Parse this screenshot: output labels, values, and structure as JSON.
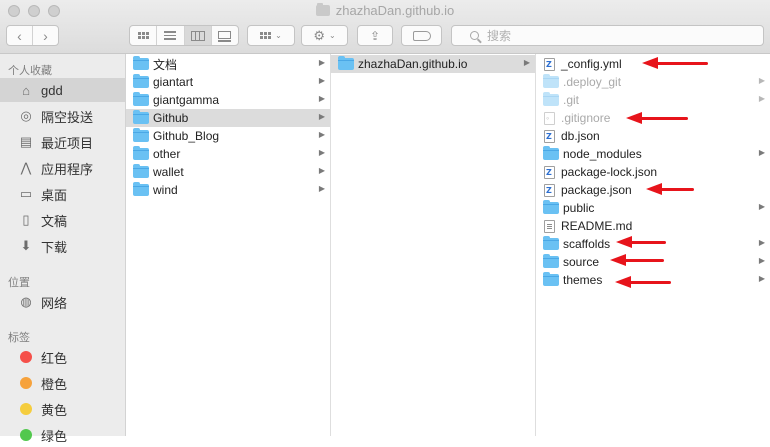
{
  "window": {
    "title": "zhazhaDan.github.io"
  },
  "toolbar": {
    "back_icon": "chevron-left-icon",
    "forward_icon": "chevron-right-icon",
    "share_icon": "share-icon",
    "tag_icon": "tag-icon",
    "action_icon": "gear-icon",
    "search": {
      "placeholder": "搜索"
    }
  },
  "sidebar": {
    "favorites_header": "个人收藏",
    "favorites": [
      {
        "label": "gdd",
        "icon": "home-icon",
        "selected": true
      },
      {
        "label": "隔空投送",
        "icon": "airdrop-icon"
      },
      {
        "label": "最近项目",
        "icon": "recents-icon"
      },
      {
        "label": "应用程序",
        "icon": "applications-icon"
      },
      {
        "label": "桌面",
        "icon": "desktop-icon"
      },
      {
        "label": "文稿",
        "icon": "documents-icon"
      },
      {
        "label": "下载",
        "icon": "downloads-icon"
      }
    ],
    "locations_header": "位置",
    "locations": [
      {
        "label": "网络",
        "icon": "network-icon"
      }
    ],
    "tags_header": "标签",
    "tags": [
      {
        "label": "红色",
        "color": "#f5504a"
      },
      {
        "label": "橙色",
        "color": "#f6a23c"
      },
      {
        "label": "黄色",
        "color": "#f5cd3e"
      },
      {
        "label": "绿色",
        "color": "#52c84e"
      }
    ]
  },
  "columns": {
    "col1": [
      {
        "name": "文档",
        "selected": false
      },
      {
        "name": "giantart",
        "selected": false
      },
      {
        "name": "giantgamma",
        "selected": false
      },
      {
        "name": "Github",
        "selected": true
      },
      {
        "name": "Github_Blog",
        "selected": false
      },
      {
        "name": "other",
        "selected": false
      },
      {
        "name": "wallet",
        "selected": false
      },
      {
        "name": "wind",
        "selected": false
      }
    ],
    "col2": [
      {
        "name": "zhazhaDan.github.io",
        "selected": true
      }
    ],
    "col3": [
      {
        "name": "_config.yml",
        "kind": "file",
        "highlighted": true
      },
      {
        "name": ".deploy_git",
        "kind": "folder",
        "dim": true
      },
      {
        "name": ".git",
        "kind": "folder",
        "dim": true
      },
      {
        "name": ".gitignore",
        "kind": "file",
        "dim": true,
        "highlighted": true
      },
      {
        "name": "db.json",
        "kind": "file"
      },
      {
        "name": "node_modules",
        "kind": "folder"
      },
      {
        "name": "package-lock.json",
        "kind": "file"
      },
      {
        "name": "package.json",
        "kind": "file",
        "highlighted": true
      },
      {
        "name": "public",
        "kind": "folder"
      },
      {
        "name": "README.md",
        "kind": "file"
      },
      {
        "name": "scaffolds",
        "kind": "folder",
        "highlighted": true
      },
      {
        "name": "source",
        "kind": "folder",
        "highlighted": true
      },
      {
        "name": "themes",
        "kind": "folder",
        "highlighted": true
      }
    ]
  },
  "annotation_color": "#e7141b"
}
